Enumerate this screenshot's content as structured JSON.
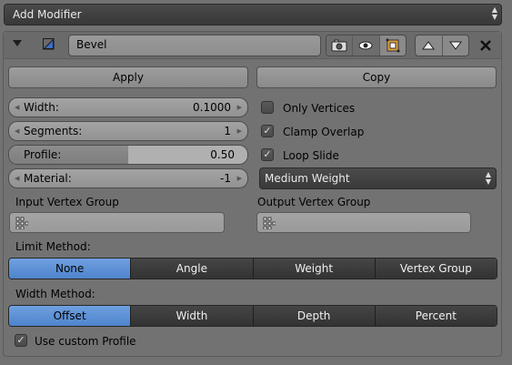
{
  "add_modifier": {
    "label": "Add Modifier"
  },
  "modifier": {
    "name": "Bevel",
    "apply_label": "Apply",
    "copy_label": "Copy"
  },
  "fields": {
    "width": {
      "label": "Width:",
      "value": "0.1000"
    },
    "segments": {
      "label": "Segments:",
      "value": "1"
    },
    "profile": {
      "label": "Profile:",
      "value": "0.50",
      "fraction": 0.5
    },
    "material": {
      "label": "Material:",
      "value": "-1"
    }
  },
  "options": {
    "only_vertices": {
      "label": "Only Vertices",
      "checked": false
    },
    "clamp_overlap": {
      "label": "Clamp Overlap",
      "checked": true
    },
    "loop_slide": {
      "label": "Loop Slide",
      "checked": true
    },
    "weight_mode": "Medium Weight"
  },
  "vertex_groups": {
    "input_label": "Input Vertex Group",
    "output_label": "Output Vertex Group"
  },
  "limit_method": {
    "label": "Limit Method:",
    "options": [
      "None",
      "Angle",
      "Weight",
      "Vertex Group"
    ],
    "selected": "None"
  },
  "width_method": {
    "label": "Width Method:",
    "options": [
      "Offset",
      "Width",
      "Depth",
      "Percent"
    ],
    "selected": "Offset"
  },
  "custom_profile": {
    "label": "Use custom Profile",
    "checked": true
  }
}
